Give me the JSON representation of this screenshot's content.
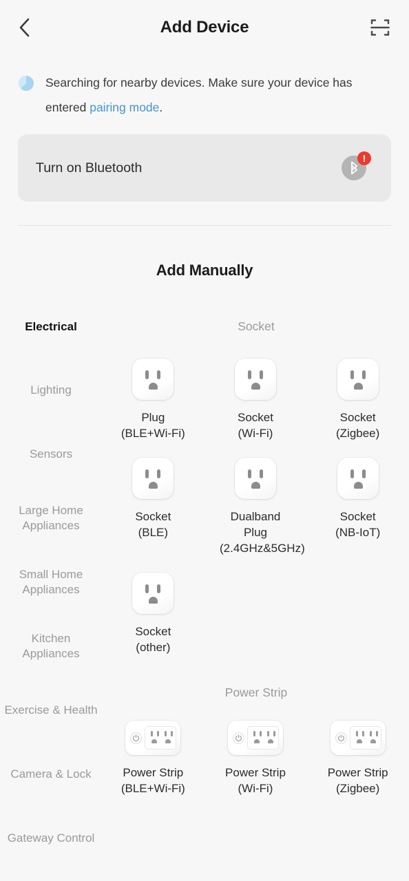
{
  "header": {
    "title": "Add Device",
    "back_icon": "chevron-left-icon",
    "scan_icon": "scan-qr-icon"
  },
  "status": {
    "spinner_icon": "loading-spinner-icon",
    "text_before": "Searching for nearby devices. Make sure your device has entered ",
    "link_text": "pairing mode",
    "text_after": ".",
    "link_color": "#4694d1"
  },
  "bluetooth_banner": {
    "label": "Turn on Bluetooth",
    "icon": "bluetooth-icon",
    "badge": "!",
    "badge_color": "#ec3a2f",
    "background": "#e9e9e9"
  },
  "section": {
    "add_manually_title": "Add Manually"
  },
  "sidebar": {
    "items": [
      {
        "label": "Electrical",
        "active": true
      },
      {
        "label": "Lighting",
        "active": false
      },
      {
        "label": "Sensors",
        "active": false
      },
      {
        "label": "Large Home Appliances",
        "active": false
      },
      {
        "label": "Small Home Appliances",
        "active": false
      },
      {
        "label": "Kitchen Appliances",
        "active": false
      },
      {
        "label": "Exercise & Health",
        "active": false
      },
      {
        "label": "Camera & Lock",
        "active": false
      },
      {
        "label": "Gateway Control",
        "active": false
      }
    ]
  },
  "groups": [
    {
      "title": "Socket",
      "icon_type": "socket",
      "devices": [
        {
          "label": "Plug\n(BLE+Wi-Fi)"
        },
        {
          "label": "Socket\n(Wi-Fi)"
        },
        {
          "label": "Socket\n(Zigbee)"
        },
        {
          "label": "Socket\n(BLE)"
        },
        {
          "label": "Dualband Plug\n(2.4GHz&5GHz)"
        },
        {
          "label": "Socket\n(NB-IoT)"
        },
        {
          "label": "Socket\n(other)"
        }
      ]
    },
    {
      "title": "Power Strip",
      "icon_type": "power-strip",
      "devices": [
        {
          "label": "Power Strip\n(BLE+Wi-Fi)"
        },
        {
          "label": "Power Strip\n(Wi-Fi)"
        },
        {
          "label": "Power Strip\n(Zigbee)"
        }
      ]
    }
  ]
}
